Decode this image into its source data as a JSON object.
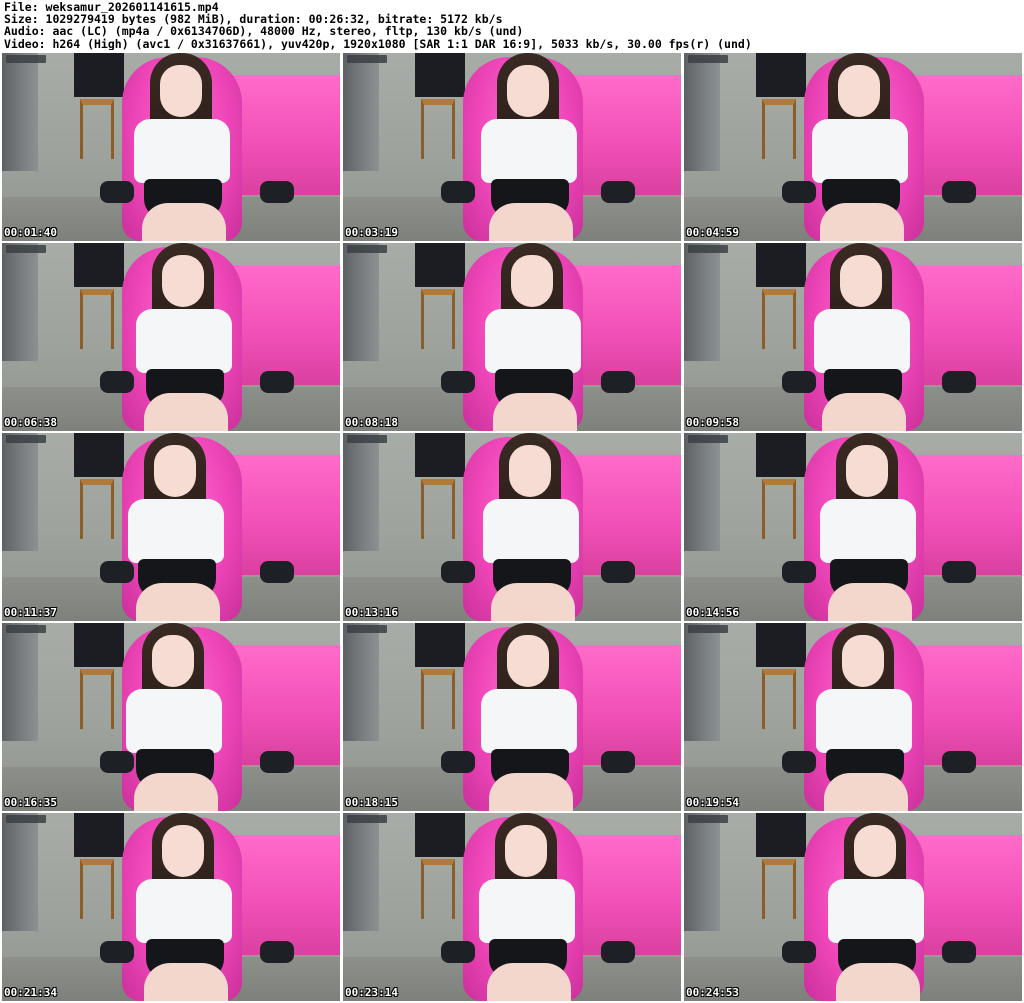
{
  "header": {
    "file_line": "File: weksamur_202601141615.mp4",
    "size_line": "Size: 1029279419 bytes (982 MiB), duration: 00:26:32, bitrate: 5172 kb/s",
    "audio_line": "Audio: aac (LC) (mp4a / 0x6134706D), 48000 Hz, stereo, fltp, 130 kb/s (und)",
    "video_line": "Video: h264 (High) (avc1 / 0x31637661), yuv420p, 1920x1080 [SAR 1:1 DAR 16:9], 5033 kb/s, 30.00 fps(r) (und)"
  },
  "thumbnails": [
    {
      "timestamp": "00:01:40"
    },
    {
      "timestamp": "00:03:19"
    },
    {
      "timestamp": "00:04:59"
    },
    {
      "timestamp": "00:06:38"
    },
    {
      "timestamp": "00:08:18"
    },
    {
      "timestamp": "00:09:58"
    },
    {
      "timestamp": "00:11:37"
    },
    {
      "timestamp": "00:13:16"
    },
    {
      "timestamp": "00:14:56"
    },
    {
      "timestamp": "00:16:35"
    },
    {
      "timestamp": "00:18:15"
    },
    {
      "timestamp": "00:19:54"
    },
    {
      "timestamp": "00:21:34"
    },
    {
      "timestamp": "00:23:14"
    },
    {
      "timestamp": "00:24:53"
    }
  ],
  "colors": {
    "header_text": "#000000",
    "timestamp_text": "#ffffff",
    "chair_pink": "#ee45b8",
    "shirt_white": "#f4f6f8",
    "shorts_black": "#14161a"
  }
}
